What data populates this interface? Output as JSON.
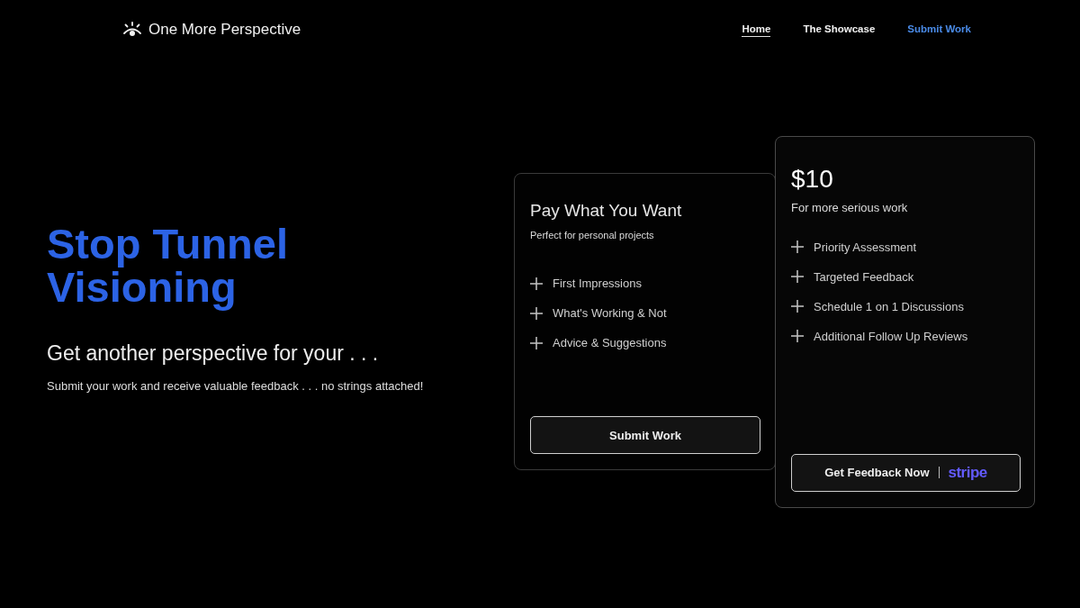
{
  "header": {
    "logo": {
      "text": "One More Perspective"
    },
    "nav": [
      {
        "label": "Home",
        "selected": true,
        "kind": "link"
      },
      {
        "label": "The Showcase",
        "selected": false,
        "kind": "link"
      },
      {
        "label": "Submit Work",
        "selected": false,
        "kind": "cta"
      }
    ]
  },
  "hero": {
    "title": "Stop Tunnel Visioning",
    "subtitle": "Get another perspective for your . . .",
    "description": "Submit your work and receive valuable feedback . . . no strings attached!"
  },
  "plans": [
    {
      "kind": "basic",
      "title": "Pay What You Want",
      "tagline": "Perfect for personal projects",
      "features": [
        "First Impressions",
        "What's Working & Not",
        "Advice & Suggestions"
      ],
      "button": {
        "label": "Submit Work"
      }
    },
    {
      "kind": "premium",
      "title": "$10",
      "tagline": "For more serious work",
      "features": [
        "Priority Assessment",
        "Targeted Feedback",
        "Schedule 1 on 1 Discussions",
        "Additional Follow Up Reviews"
      ],
      "button": {
        "label": "Get Feedback Now",
        "badge": "stripe"
      }
    }
  ]
}
